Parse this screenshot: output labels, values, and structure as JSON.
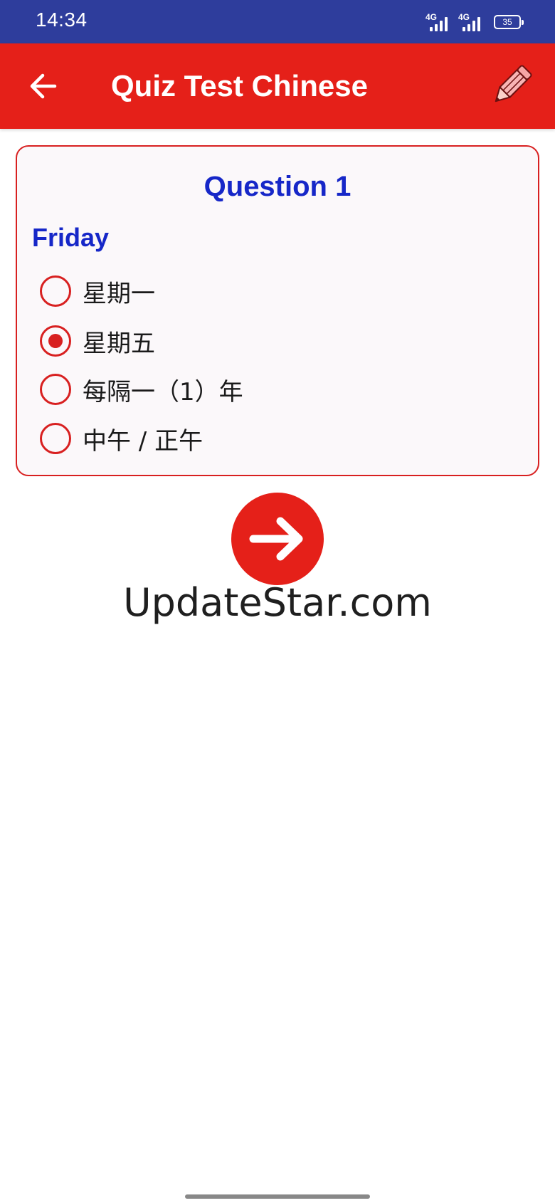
{
  "status_bar": {
    "time": "14:34",
    "network_1": "4G",
    "network_2": "4G",
    "battery": "35"
  },
  "app_bar": {
    "title": "Quiz Test Chinese",
    "back_icon": "arrow-left-icon",
    "edit_icon": "pencil-icon"
  },
  "question": {
    "title": "Question 1",
    "prompt": "Friday",
    "options": [
      {
        "label": "星期一",
        "selected": false
      },
      {
        "label": "星期五",
        "selected": true
      },
      {
        "label": "每隔一（1）年",
        "selected": false
      },
      {
        "label": "中午 / 正午",
        "selected": false
      }
    ]
  },
  "next_button": {
    "icon": "arrow-right-icon"
  },
  "watermark": "UpdateStar.com",
  "colors": {
    "status_bar": "#2e3d9c",
    "app_bar": "#e52019",
    "accent_red": "#d82020",
    "question_blue": "#1627c8",
    "card_background": "#fbf8fa"
  }
}
